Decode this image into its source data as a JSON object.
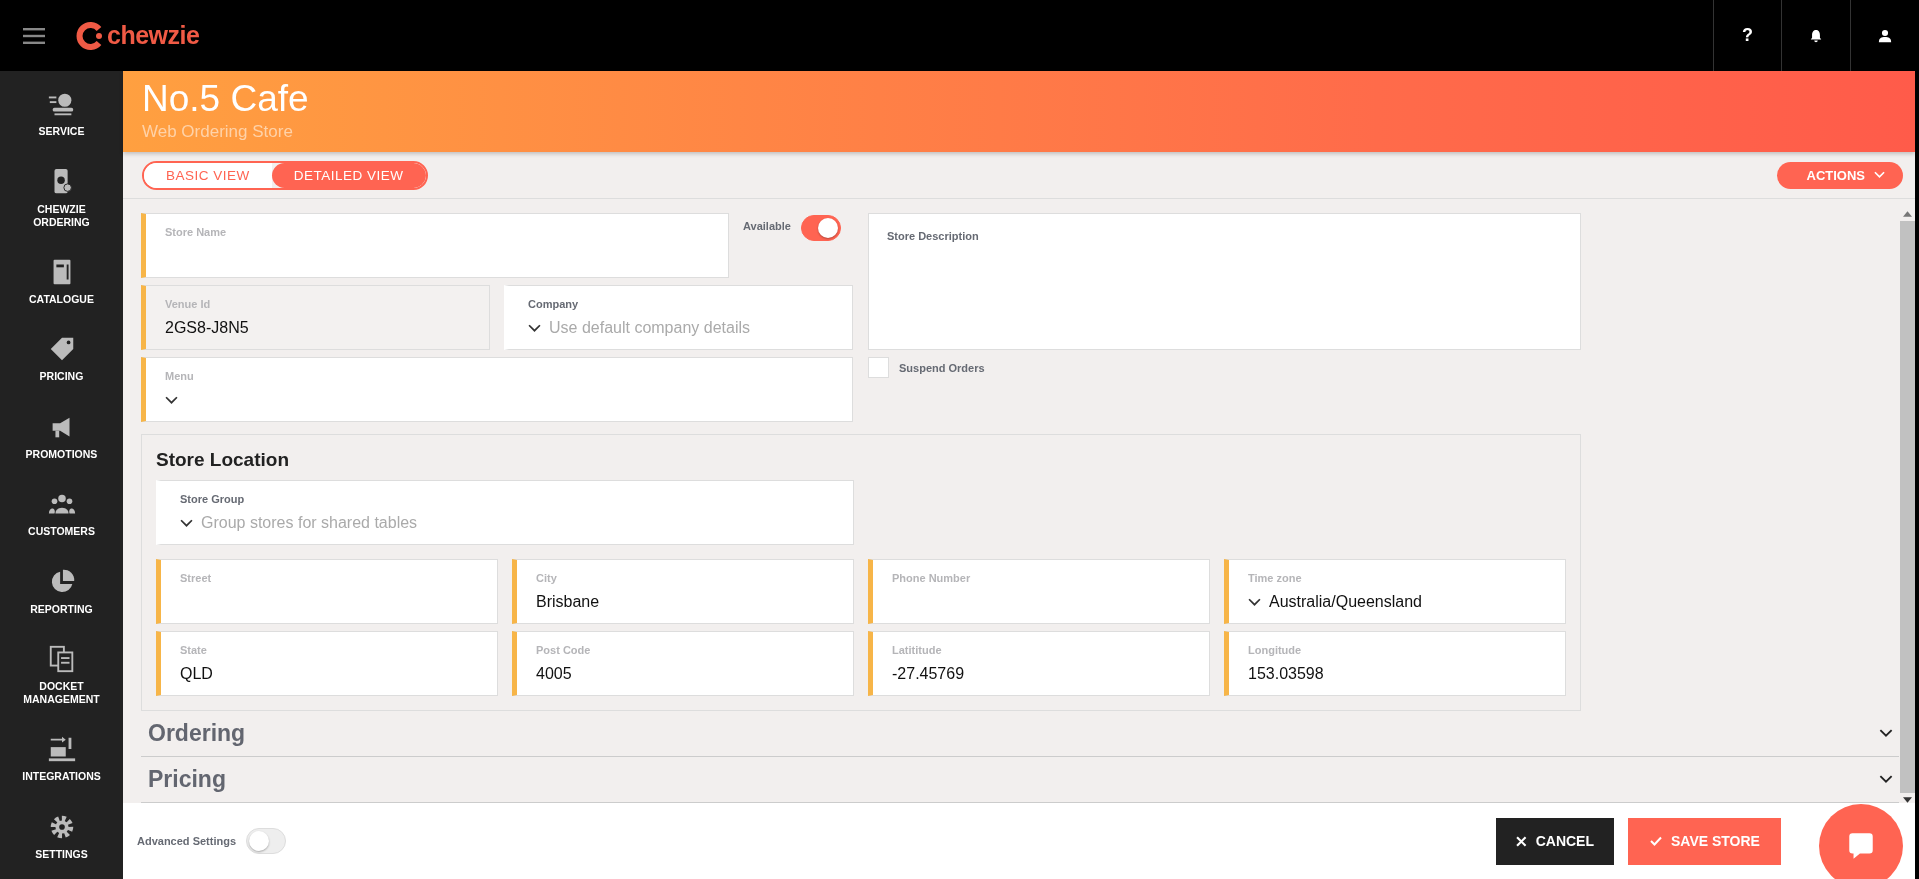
{
  "top_bar": {
    "logo": "chewzie",
    "icons": [
      "?"
    ]
  },
  "sidebar": {
    "items": [
      {
        "label": "SERVICE"
      },
      {
        "label": "CHEWZIE ORDERING"
      },
      {
        "label": "CATALOGUE"
      },
      {
        "label": "PRICING"
      },
      {
        "label": "PROMOTIONS"
      },
      {
        "label": "CUSTOMERS"
      },
      {
        "label": "REPORTING"
      },
      {
        "label": "DOCKET MANAGEMENT"
      },
      {
        "label": "INTEGRATIONS"
      },
      {
        "label": "SETTINGS"
      }
    ]
  },
  "header": {
    "title": "No.5 Cafe",
    "subtitle": "Web Ordering Store"
  },
  "tabs": [
    {
      "label": "BASIC VIEW",
      "selected": false
    },
    {
      "label": "DETAILED VIEW",
      "selected": true
    }
  ],
  "actions_button": "ACTIONS",
  "store_name": {
    "label": "Store Name",
    "required": true
  },
  "available": {
    "label": "Available",
    "on": true
  },
  "venue_id": {
    "label": "Venue Id",
    "value": "2GS8-J8N5",
    "required": true,
    "disabled": true
  },
  "company": {
    "label": "Company",
    "placeholder": "Use default company details",
    "required": false
  },
  "menu": {
    "label": "Menu",
    "required": true
  },
  "store_description": {
    "label": "Store Description"
  },
  "suspend_orders": {
    "label": "Suspend Orders",
    "checked": false
  },
  "store_location": {
    "title": "Store Location",
    "store_group": {
      "label": "Store Group",
      "placeholder": "Group stores for shared tables"
    },
    "fields": [
      {
        "label": "Street",
        "kind": "text",
        "required": true
      },
      {
        "label": "City",
        "kind": "text",
        "value": "Brisbane",
        "required": true
      },
      {
        "label": "Phone Number",
        "kind": "text",
        "required": true
      },
      {
        "label": "Time zone",
        "kind": "select",
        "value": "Australia/Queensland",
        "required": true
      },
      {
        "label": "State",
        "kind": "text",
        "value": "QLD",
        "required": true
      },
      {
        "label": "Post Code",
        "kind": "text",
        "value": "4005",
        "required": true
      },
      {
        "label": "Latititude",
        "kind": "text",
        "value": "-27.45769",
        "required": true
      },
      {
        "label": "Longitude",
        "kind": "text",
        "value": "153.03598",
        "required": true
      }
    ]
  },
  "sections": [
    {
      "title": "Ordering",
      "expanded": false
    },
    {
      "title": "Pricing",
      "expanded": false
    }
  ],
  "footer": {
    "advanced_settings": {
      "label": "Advanced Settings",
      "on": false
    },
    "cancel": "CANCEL",
    "save": "SAVE STORE"
  }
}
